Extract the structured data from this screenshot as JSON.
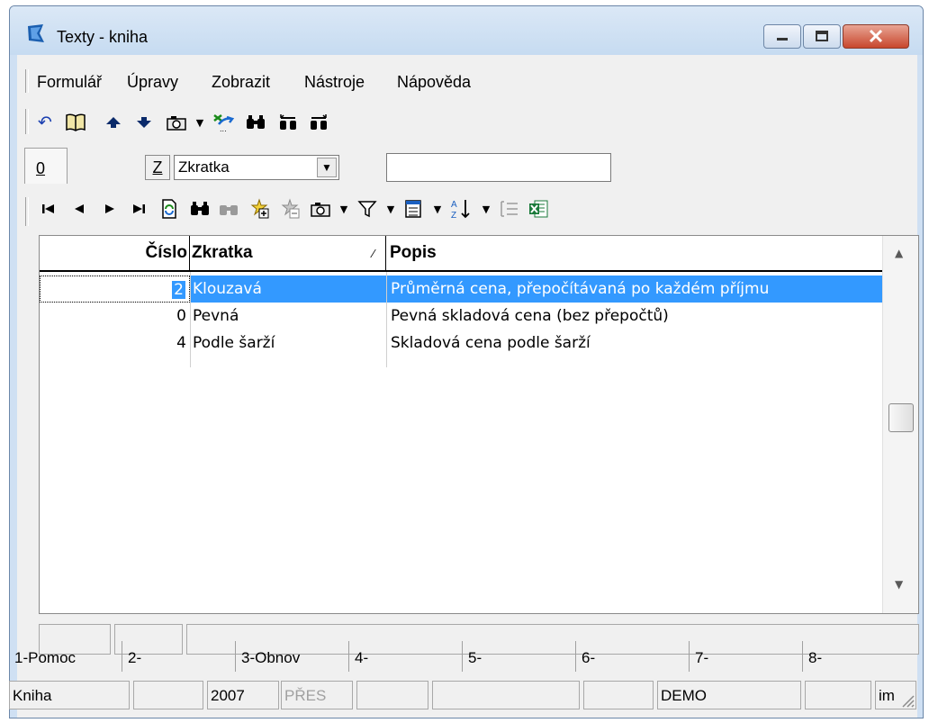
{
  "window": {
    "title": "Texty - kniha"
  },
  "menu": {
    "items": [
      "Formulář",
      "Úpravy",
      "Zobrazit",
      "Nástroje",
      "Nápověda"
    ]
  },
  "filter": {
    "tab_label": "0",
    "z_button": "Z",
    "field_value": "Zkratka",
    "search_value": ""
  },
  "grid": {
    "headers": {
      "cislo": "Číslo",
      "zkratka": "Zkratka",
      "sort_marker": "⁄",
      "popis": "Popis"
    },
    "rows": [
      {
        "cislo": "2",
        "zkratka": "Klouzavá",
        "popis": "Průměrná cena, přepočítávaná po každém příjmu",
        "selected": true
      },
      {
        "cislo": "0",
        "zkratka": "Pevná",
        "popis": "Pevná skladová cena (bez přepočtů)",
        "selected": false
      },
      {
        "cislo": "4",
        "zkratka": "Podle šarží",
        "popis": "Skladová cena podle šarží",
        "selected": false
      }
    ]
  },
  "function_keys": [
    "1-Pomoc",
    "2-",
    "3-Obnov",
    "4-",
    "5-",
    "6-",
    "7-",
    "8-"
  ],
  "status": {
    "module": "Kniha",
    "year": "2007",
    "mode": "PŘES",
    "database": "DEMO",
    "user": "im"
  },
  "colors": {
    "selection": "#3399ff",
    "window_frame": "#cfe0f3",
    "close_button": "#c8472d"
  }
}
